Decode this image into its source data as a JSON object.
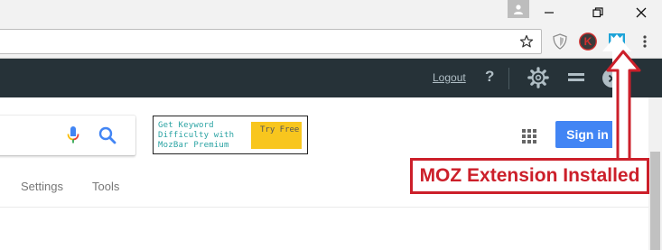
{
  "browser": {
    "profile_icon": "person-icon",
    "window_controls": {
      "minimize": "minimize-icon",
      "restore": "restore-icon",
      "close": "close-icon"
    },
    "omnibox": {
      "value": "",
      "bookmark_icon": "star-icon"
    },
    "extensions": [
      {
        "name": "shield-extension",
        "icon": "shield-icon"
      },
      {
        "name": "k-extension",
        "icon": "k-badge-icon",
        "letter": "K",
        "color": "#d32f2f"
      },
      {
        "name": "moz-extension",
        "icon": "moz-m-icon",
        "letter": "M",
        "color": "#1ea3d7"
      }
    ],
    "menu_icon": "kebab-menu-icon"
  },
  "mozbar": {
    "logout_label": "Logout",
    "help_label": "?",
    "background": "#263238"
  },
  "google": {
    "searchbox": {
      "value": ""
    },
    "ad": {
      "text": "Get Keyword Difficulty with MozBar Premium",
      "button_label": "Try Free",
      "button_color": "#f8c61e"
    },
    "signin_label": "Sign in",
    "signin_color": "#4285f4",
    "tabs": [
      {
        "label": "Settings"
      },
      {
        "label": "Tools"
      }
    ]
  },
  "annotation": {
    "label": "MOZ Extension Installed",
    "color": "#cc1f2a"
  }
}
